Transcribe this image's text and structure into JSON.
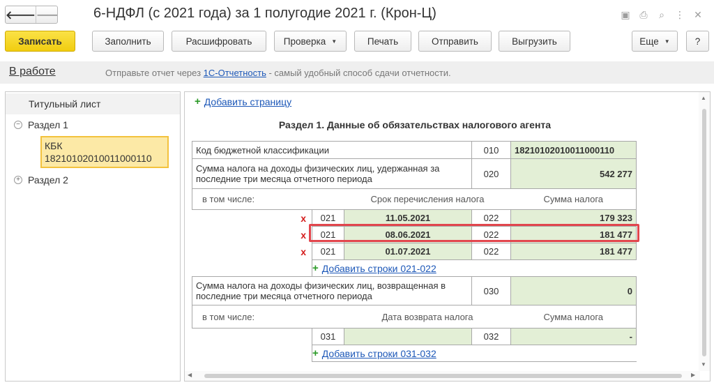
{
  "window": {
    "title": "6-НДФЛ (с 2021 года) за 1 полугодие 2021 г. (Крон-Ц)",
    "nav": {
      "back": "🡐",
      "forward": "🡒"
    },
    "icons": [
      "save-icon",
      "print-icon",
      "preview-icon",
      "menu-icon",
      "close-icon"
    ],
    "icon_glyphs": {
      "save": "▣",
      "print": "⎙",
      "preview": "⌕",
      "menu": "⋮",
      "close": "✕"
    }
  },
  "toolbar": {
    "save_label": "Записать",
    "fill_label": "Заполнить",
    "decode_label": "Расшифровать",
    "check_label": "Проверка",
    "print_label": "Печать",
    "send_label": "Отправить",
    "export_label": "Выгрузить",
    "more_label": "Еще",
    "help_label": "?",
    "caret": "▼"
  },
  "infobar": {
    "status": "В работе",
    "text_before": "Отправьте отчет через ",
    "link": "1С-Отчетность",
    "text_after": " - самый удобный способ сдачи отчетности."
  },
  "tree": {
    "title_sheet": "Титульный лист",
    "section1": "Раздел 1",
    "section1_toggle": "−",
    "kbk_label": "КБК",
    "kbk_value": "18210102010011000110",
    "section2": "Раздел 2",
    "section2_toggle": "+"
  },
  "form": {
    "add_page_label": "Добавить страницу",
    "plus": "+",
    "heading": "Раздел 1. Данные об обязательствах налогового агента",
    "kbk": {
      "label": "Код бюджетной классификации",
      "code": "010",
      "value": "18210102010011000110"
    },
    "withheld": {
      "label": "Сумма налога на доходы физических лиц, удержанная за последние три месяца отчетного периода",
      "code": "020",
      "value": "542 277"
    },
    "sub_header_1": {
      "label": "в том числе:",
      "col1": "Срок перечисления налога",
      "col2": "Сумма налога"
    },
    "rows_021": [
      {
        "x": "x",
        "code1": "021",
        "date": "11.05.2021",
        "code2": "022",
        "amount": "179 323"
      },
      {
        "x": "x",
        "code1": "021",
        "date": "08.06.2021",
        "code2": "022",
        "amount": "181 477"
      },
      {
        "x": "x",
        "code1": "021",
        "date": "01.07.2021",
        "code2": "022",
        "amount": "181 477"
      }
    ],
    "add_rows_021_label": "Добавить строки 021-022",
    "returned": {
      "label": "Сумма налога на доходы физических лиц, возвращенная в последние три месяца отчетного периода",
      "code": "030",
      "value": "0"
    },
    "sub_header_2": {
      "label": "в том числе:",
      "col1": "Дата возврата налога",
      "col2": "Сумма налога"
    },
    "row_031": {
      "code1": "031",
      "date": "",
      "code2": "032",
      "amount": "-"
    },
    "add_rows_031_label": "Добавить строки 031-032"
  },
  "colors": {
    "accent_yellow": "#f3c23d",
    "green_cell": "#e3efd6",
    "highlight_red": "#e2464d",
    "link_blue": "#1d58b8",
    "plus_green": "#2a9a26"
  }
}
